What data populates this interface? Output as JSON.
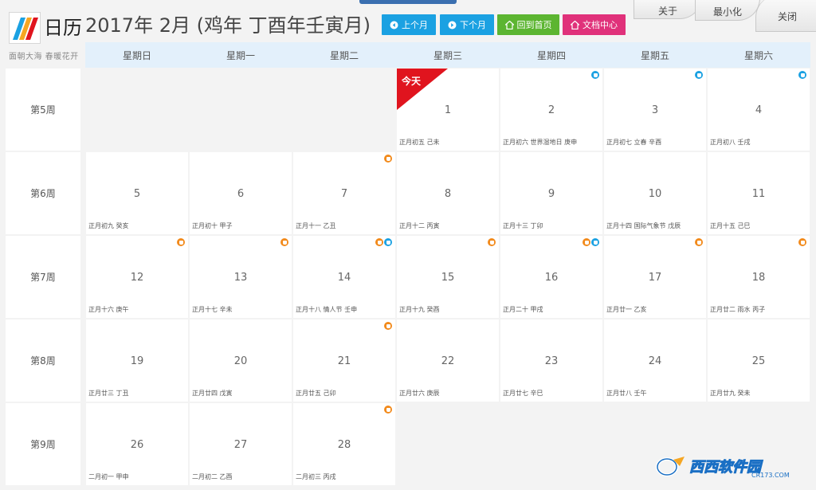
{
  "app": {
    "name": "日历",
    "slogan": "面朝大海  春暖花开",
    "title": "2017年 2月 (鸡年 丁酉年壬寅月)"
  },
  "toolbar": {
    "prev_label": "上个月",
    "next_label": "下个月",
    "home_label": "回到首页",
    "docs_label": "文档中心"
  },
  "window": {
    "about_label": "关于",
    "minimize_label": "最小化",
    "close_label": "关闭"
  },
  "weekdays": [
    "星期日",
    "星期一",
    "星期二",
    "星期三",
    "星期四",
    "星期五",
    "星期六"
  ],
  "weeks": [
    "第5周",
    "第6周",
    "第7周",
    "第8周",
    "第9周"
  ],
  "today_label": "今天",
  "days": [
    {
      "day": "1",
      "lunar": "正月初五   己未",
      "badges": [],
      "today": true
    },
    {
      "day": "2",
      "lunar": "正月初六  世界湿地日  庚申",
      "badges": [
        "blue"
      ]
    },
    {
      "day": "3",
      "lunar": "正月初七 立春   辛酉",
      "badges": [
        "blue"
      ]
    },
    {
      "day": "4",
      "lunar": "正月初八    壬戌",
      "badges": [
        "blue"
      ]
    },
    {
      "day": "5",
      "lunar": "正月初九    癸亥",
      "badges": []
    },
    {
      "day": "6",
      "lunar": "正月初十    甲子",
      "badges": []
    },
    {
      "day": "7",
      "lunar": "正月十一    乙丑",
      "badges": [
        "orange"
      ]
    },
    {
      "day": "8",
      "lunar": "正月十二    丙寅",
      "badges": []
    },
    {
      "day": "9",
      "lunar": "正月十三    丁卯",
      "badges": []
    },
    {
      "day": "10",
      "lunar": "正月十四  国际气象节  戊辰",
      "badges": []
    },
    {
      "day": "11",
      "lunar": "正月十五    己巳",
      "badges": []
    },
    {
      "day": "12",
      "lunar": "正月十六    庚午",
      "badges": [
        "orange"
      ]
    },
    {
      "day": "13",
      "lunar": "正月十七    辛未",
      "badges": [
        "orange"
      ]
    },
    {
      "day": "14",
      "lunar": "正月十八  情人节  壬申",
      "badges": [
        "orange",
        "blue"
      ]
    },
    {
      "day": "15",
      "lunar": "正月十九    癸酉",
      "badges": [
        "orange"
      ]
    },
    {
      "day": "16",
      "lunar": "正月二十    甲戌",
      "badges": [
        "orange",
        "blue"
      ]
    },
    {
      "day": "17",
      "lunar": "正月廿一    乙亥",
      "badges": [
        "orange"
      ]
    },
    {
      "day": "18",
      "lunar": "正月廿二 雨水  丙子",
      "badges": [
        "orange"
      ]
    },
    {
      "day": "19",
      "lunar": "正月廿三    丁丑",
      "badges": []
    },
    {
      "day": "20",
      "lunar": "正月廿四    戊寅",
      "badges": []
    },
    {
      "day": "21",
      "lunar": "正月廿五    己卯",
      "badges": [
        "orange"
      ]
    },
    {
      "day": "22",
      "lunar": "正月廿六    庚辰",
      "badges": []
    },
    {
      "day": "23",
      "lunar": "正月廿七    辛巳",
      "badges": []
    },
    {
      "day": "24",
      "lunar": "正月廿八    壬午",
      "badges": []
    },
    {
      "day": "25",
      "lunar": "正月廿九    癸未",
      "badges": []
    },
    {
      "day": "26",
      "lunar": "二月初一    甲申",
      "badges": []
    },
    {
      "day": "27",
      "lunar": "二月初二    乙酉",
      "badges": []
    },
    {
      "day": "28",
      "lunar": "二月初三    丙戌",
      "badges": [
        "orange"
      ]
    }
  ],
  "watermark": {
    "brand": "西西软件园",
    "url": "CR173.COM"
  },
  "colors": {
    "blue_button": "#1ba1e2",
    "green_button": "#5cb531",
    "pink_button": "#e0317a",
    "today_flag": "#e0141e",
    "header_bg": "#e3f0fb"
  }
}
